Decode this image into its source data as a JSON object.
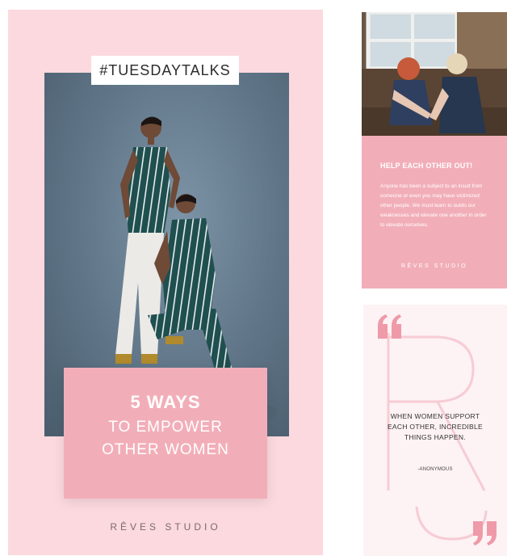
{
  "left_card": {
    "hashtag": "#TUESDAYTALKS",
    "title_line1": "5 WAYS",
    "title_line2": "TO EMPOWER",
    "title_line3": "OTHER WOMEN",
    "brand": "RÊVES  STUDIO"
  },
  "top_right_card": {
    "heading": "HELP EACH OTHER OUT!",
    "body": "Anyone has been a subject to an insult from someone or even you may have victimized other people. We must learn to outdo our weaknesses and elevate one another in order to elevate ourselves.",
    "brand": "RÊVES  STUDIO"
  },
  "bottom_right_card": {
    "quote": "WHEN WOMEN SUPPORT EACH OTHER, INCREDIBLE THINGS HAPPEN.",
    "attribution": "-ANONYMOUS"
  },
  "colors": {
    "blush": "#fbd9df",
    "rose": "#f2aeb8",
    "pale": "#fdf2f4",
    "photo_backdrop": "#5f7587",
    "outfit_green": "#1f4f4f"
  }
}
